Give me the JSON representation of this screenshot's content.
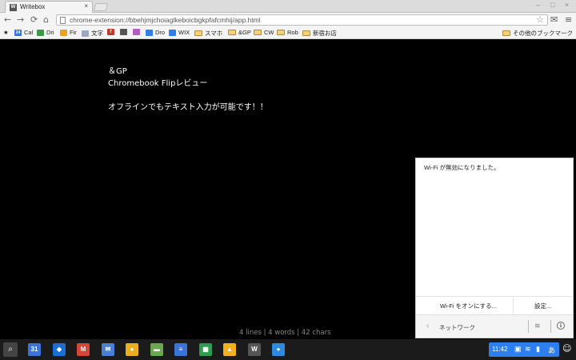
{
  "browser": {
    "tab_title": "Writebox",
    "tab_favicon": "W",
    "tab_close": "×",
    "url": "chrome-extension://bbehjmjchoiaglkeboicbgkpfafcmhij/app.html"
  },
  "bookmarks": [
    {
      "label": "Cal",
      "icon": "calendar-icon",
      "color": "#3b73d6",
      "badge": "24"
    },
    {
      "label": "Dri",
      "icon": "drive-icon",
      "color": "#3a9a4a",
      "badge": ""
    },
    {
      "label": "Fir",
      "icon": "firebase-icon",
      "color": "#f0a020",
      "badge": ""
    },
    {
      "label": "文字",
      "icon": "page-icon",
      "color": "#9aa8c0",
      "badge": ""
    },
    {
      "label": "",
      "icon": "app-icon",
      "color": "#c0392b",
      "badge": "T"
    },
    {
      "label": "",
      "icon": "face-icon",
      "color": "#555555",
      "badge": ""
    },
    {
      "label": "",
      "icon": "bar-icon",
      "color": "#b05fc0",
      "badge": ""
    },
    {
      "label": "Dro",
      "icon": "dropbox-icon",
      "color": "#2d7ff0",
      "badge": ""
    },
    {
      "label": "WIX",
      "icon": "wix-icon",
      "color": "#2d7ff0",
      "badge": ""
    },
    {
      "label": "スマホ",
      "icon": "folder-icon",
      "color": "#f3d27a",
      "badge": ""
    },
    {
      "label": "&GP",
      "icon": "folder-icon",
      "color": "#f3d27a",
      "badge": ""
    },
    {
      "label": "CW",
      "icon": "folder-icon",
      "color": "#f3d27a",
      "badge": ""
    },
    {
      "label": "Rob",
      "icon": "folder-icon",
      "color": "#f3d27a",
      "badge": ""
    },
    {
      "label": "新宿お店",
      "icon": "folder-icon",
      "color": "#f3d27a",
      "badge": ""
    }
  ],
  "other_bookmarks": "その他のブックマーク",
  "document": {
    "lines": [
      "＆GP",
      "Chromebook Flipレビュー",
      "",
      "オフラインでもテキスト入力が可能です！！"
    ],
    "stats": "4 lines | 4 words | 42 chars"
  },
  "notification": {
    "message": "Wi-Fi が無効になりました。",
    "action_enable": "Wi-Fi をオンにする...",
    "action_settings": "設定...",
    "network_label": "ネットワーク"
  },
  "shelf": {
    "apps": [
      {
        "name": "calendar-app",
        "color": "#3b73d6",
        "glyph": "31"
      },
      {
        "name": "dropbox-app",
        "color": "#1a6fd6",
        "glyph": "◆"
      },
      {
        "name": "gmail-app",
        "color": "#d44638",
        "glyph": "M"
      },
      {
        "name": "inbox-app",
        "color": "#4a7fd6",
        "glyph": "✉"
      },
      {
        "name": "chrome-app",
        "color": "#e8b020",
        "glyph": "●"
      },
      {
        "name": "game-app",
        "color": "#6aa84f",
        "glyph": "▬"
      },
      {
        "name": "docs-app",
        "color": "#3b73d6",
        "glyph": "≡"
      },
      {
        "name": "sheets-app",
        "color": "#2e9b4e",
        "glyph": "▦"
      },
      {
        "name": "drive-app",
        "color": "#f2b01e",
        "glyph": "▲"
      },
      {
        "name": "writebox-app",
        "color": "#555555",
        "glyph": "W"
      },
      {
        "name": "files-app",
        "color": "#2d8ae0",
        "glyph": "●"
      }
    ],
    "time": "11:42",
    "ime": "あ"
  }
}
